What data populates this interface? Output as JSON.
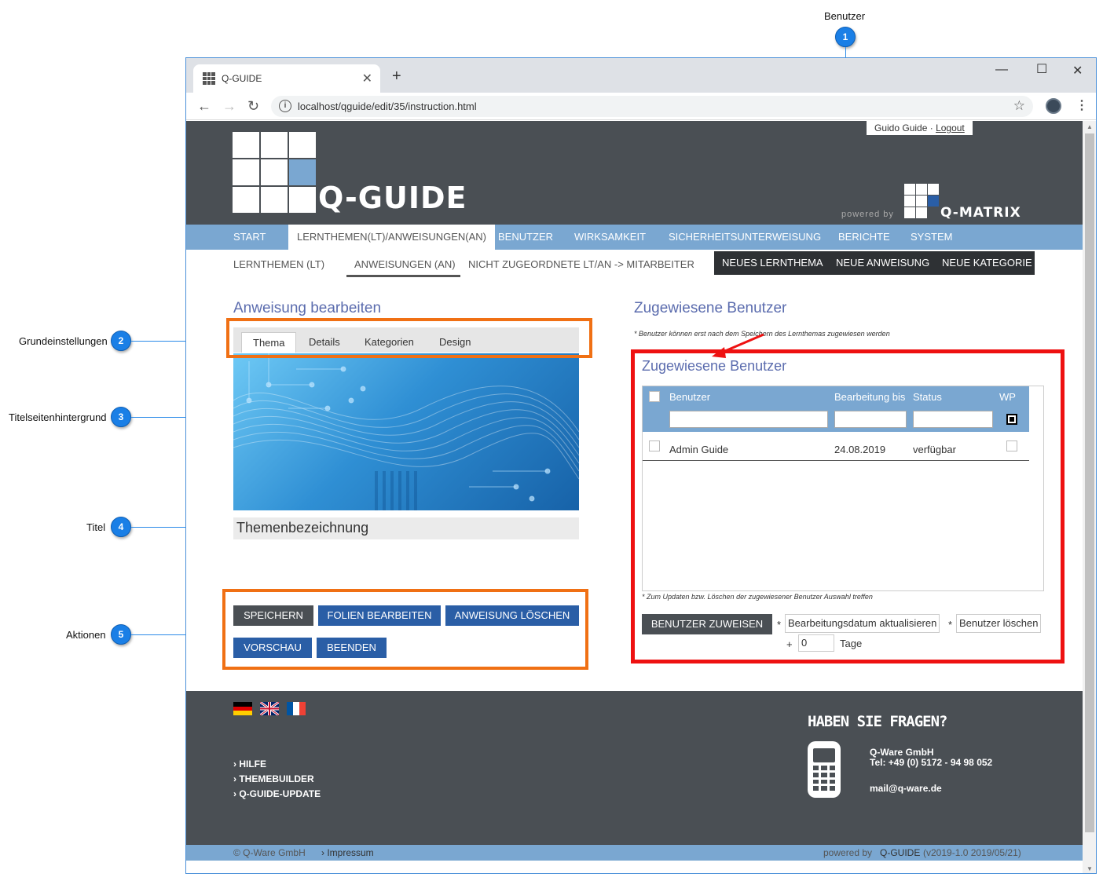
{
  "annotations": [
    {
      "num": "1",
      "label": "Benutzer"
    },
    {
      "num": "2",
      "label": "Grundeinstellungen"
    },
    {
      "num": "3",
      "label": "Titelseitenhintergrund"
    },
    {
      "num": "4",
      "label": "Titel"
    },
    {
      "num": "5",
      "label": "Aktionen"
    }
  ],
  "browser": {
    "tab_title": "Q-GUIDE",
    "new_tab": "+",
    "url": "localhost/qguide/edit/35/instruction.html"
  },
  "header": {
    "user_name": "Guido Guide",
    "separator": " · ",
    "logout": "Logout",
    "logo_text": "Q-GUIDE",
    "powered_by": "powered by",
    "qmatrix_text": "Q-MATRIX"
  },
  "mainnav": [
    {
      "label": "START"
    },
    {
      "label": "LERNTHEMEN(LT)/ANWEISUNGEN(AN)"
    },
    {
      "label": "BENUTZER"
    },
    {
      "label": "WIRKSAMKEIT"
    },
    {
      "label": "SICHERHEITSUNTERWEISUNG"
    },
    {
      "label": "BERICHTE"
    },
    {
      "label": "SYSTEM"
    }
  ],
  "subnav": [
    {
      "label": "LERNTHEMEN (LT)"
    },
    {
      "label": "ANWEISUNGEN (AN)"
    },
    {
      "label": "NICHT ZUGEORDNETE LT/AN -> MITARBEITER"
    }
  ],
  "actions": [
    {
      "label": "NEUES LERNTHEMA"
    },
    {
      "label": "NEUE ANWEISUNG"
    },
    {
      "label": "NEUE KATEGORIE"
    }
  ],
  "left": {
    "title": "Anweisung bearbeiten",
    "tabs": [
      {
        "label": "Thema"
      },
      {
        "label": "Details"
      },
      {
        "label": "Kategorien"
      },
      {
        "label": "Design"
      }
    ],
    "title_field": "Themenbezeichnung",
    "buttons": {
      "save": "SPEICHERN",
      "edit_slides": "FOLIEN BEARBEITEN",
      "delete": "ANWEISUNG LÖSCHEN",
      "preview": "VORSCHAU",
      "finish": "BEENDEN"
    }
  },
  "right": {
    "title": "Zugewiesene Benutzer",
    "note": "* Benutzer können erst nach dem Speichern des Lernthemas zugewiesen werden",
    "panel_title": "Zugewiesene Benutzer",
    "columns": {
      "user": "Benutzer",
      "until": "Bearbeitung bis",
      "status": "Status",
      "wp": "WP"
    },
    "rows": [
      {
        "user": "Admin Guide",
        "until": "24.08.2019",
        "status": "verfügbar"
      }
    ],
    "update_note": "* Zum Updaten bzw. Löschen der zugewiesener Benutzer Auswahl treffen",
    "assign_button": "BENUTZER ZUWEISEN",
    "star": "*",
    "update_date": "Bearbeitungsdatum aktualisieren",
    "delete_user": "Benutzer löschen",
    "plus": "+",
    "days_value": "0",
    "days_label": "Tage"
  },
  "footer": {
    "links": [
      {
        "label": "› HILFE"
      },
      {
        "label": "› THEMEBUILDER"
      },
      {
        "label": "› Q-GUIDE-UPDATE"
      }
    ],
    "faq_title": "HABEN SIE FRAGEN?",
    "company": "Q-Ware GmbH",
    "phone": "Tel: +49 (0) 5172 - 94 98 052",
    "email": "mail@q-ware.de",
    "copyright": "© Q-Ware GmbH",
    "impressum": "› Impressum",
    "powered_prefix": "powered by",
    "powered_name": "Q-GUIDE",
    "version": "(v2019-1.0 2019/05/21)"
  },
  "colors": {
    "annotation_blue": "#1a7fe6",
    "highlight_orange": "#f07014",
    "highlight_red": "#ee1111",
    "nav_blue": "#7aa7d1",
    "header_gray": "#4a4f54",
    "button_blue": "#2a5ea6",
    "title_purple": "#5b6cae"
  }
}
